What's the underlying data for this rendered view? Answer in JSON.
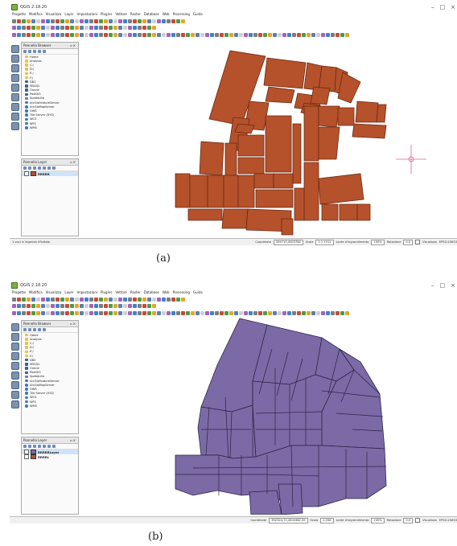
{
  "window": {
    "title": "QGIS 2.18.20",
    "controls": [
      "–",
      "□",
      "×"
    ]
  },
  "menu": [
    "Progetto",
    "Modifica",
    "Visualizza",
    "Layer",
    "Impostazioni",
    "Plugins",
    "Vettore",
    "Raster",
    "Database",
    "Web",
    "Processing",
    "Guida"
  ],
  "browser": {
    "title": "Pannello Browser",
    "items": [
      {
        "label": "Home",
        "icon": "folder-icon"
      },
      {
        "label": "Analysis",
        "icon": "folder-icon"
      },
      {
        "label": "C:/",
        "icon": "folder-icon"
      },
      {
        "label": "D:/",
        "icon": "folder-icon"
      },
      {
        "label": "E:/",
        "icon": "folder-icon"
      },
      {
        "label": "F:/",
        "icon": "folder-icon"
      },
      {
        "label": "DB2",
        "icon": "database-icon"
      },
      {
        "label": "MSSQL",
        "icon": "database-icon"
      },
      {
        "label": "Oracle",
        "icon": "database-icon"
      },
      {
        "label": "PostGIS",
        "icon": "database-icon"
      },
      {
        "label": "SpatiaLite",
        "icon": "feather-icon"
      },
      {
        "label": "ArcGisFeatureServer",
        "icon": "globe-icon"
      },
      {
        "label": "ArcGisMapServer",
        "icon": "globe-icon"
      },
      {
        "label": "OWS",
        "icon": "globe-icon"
      },
      {
        "label": "Tile Server (XYZ)",
        "icon": "globe-icon"
      },
      {
        "label": "WCS",
        "icon": "globe-icon"
      },
      {
        "label": "WFS",
        "icon": "globe-icon"
      },
      {
        "label": "WMS",
        "icon": "globe-icon"
      }
    ]
  },
  "layers_title": "Pannello Layer",
  "panel_a": {
    "caption": "(a)",
    "layers": [
      {
        "label": "RRRRR",
        "color": "#b5512b"
      }
    ],
    "status_left": "1 voci in legenda rifinitate",
    "coordinate_label": "Coordinate",
    "coordinate_value": "394710,4503780",
    "scale_label": "Scala",
    "scale_value": "1:1 1511",
    "magnifier_label": "Lente d'ingrandimento",
    "magnifier_value": "100%",
    "rotation_label": "Rotazione",
    "rotation_value": "0,0",
    "render_label": "Visualizza",
    "crs_label": "EPSG:25833",
    "fill_color": "#b5512b",
    "stroke_color": "#6b2a12"
  },
  "panel_b": {
    "caption": "(b)",
    "layers": [
      {
        "label": "RRRRRLayer",
        "color": "#7b6aa6"
      },
      {
        "label": "RRRRL",
        "color": "#b5512b"
      }
    ],
    "status_left": "",
    "coordinate_label": "Coordinate",
    "coordinate_value": "392324,73,4504382,35",
    "scale_label": "Scala",
    "scale_value": "1:336",
    "magnifier_label": "Lente d'ingrandimento",
    "magnifier_value": "100%",
    "rotation_label": "Rotazione",
    "rotation_value": "0,0",
    "render_label": "Visualizza",
    "crs_label": "EPSG:25833",
    "fill_color": "#7b6aa6",
    "stroke_color": "#2d2444"
  }
}
